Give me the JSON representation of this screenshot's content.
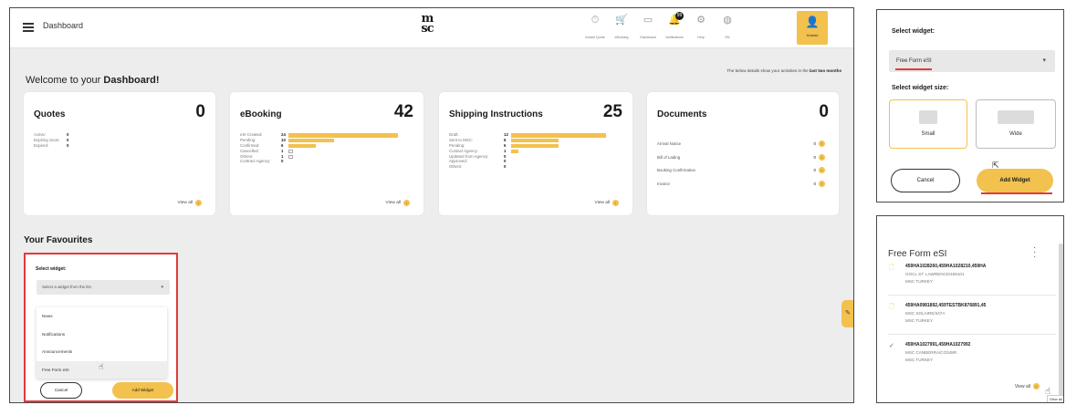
{
  "header": {
    "title": "Dashboard",
    "logo_top": "m",
    "logo_bottom": "sc",
    "nav": [
      {
        "icon": "instant-quote-icon",
        "glyph": "⏱",
        "label": "Instant Quote"
      },
      {
        "icon": "ebooking-icon",
        "glyph": "🛒",
        "label": "eBooking"
      },
      {
        "icon": "dashboard-icon",
        "glyph": "▭",
        "label": "Dashboard"
      },
      {
        "icon": "notifications-icon",
        "glyph": "🔔",
        "label": "Notifications",
        "badge": "99"
      },
      {
        "icon": "help-icon",
        "glyph": "⚙",
        "label": "Help"
      },
      {
        "icon": "language-icon",
        "glyph": "◍",
        "label": "EN"
      }
    ],
    "user_label": "Mustafa"
  },
  "welcome": {
    "prefix": "Welcome to your ",
    "bold": "Dashboard!"
  },
  "period_note": {
    "prefix": "The below details show your activities in the ",
    "bold": "last two months"
  },
  "cards": {
    "quotes": {
      "title": "Quotes",
      "count": "0",
      "rows": [
        {
          "label": "Active:",
          "value": "0"
        },
        {
          "label": "Expiring Soon:",
          "value": "0"
        },
        {
          "label": "Expired:",
          "value": "0"
        }
      ],
      "view_all": "View all"
    },
    "ebooking": {
      "title": "eBooking",
      "count": "42",
      "rows": [
        {
          "label": "eSI Created:",
          "value": "24",
          "fraction": 1.0
        },
        {
          "label": "Pending:",
          "value": "10",
          "fraction": 0.42
        },
        {
          "label": "Confirmed:",
          "value": "6",
          "fraction": 0.25
        },
        {
          "label": "Cancelled:",
          "value": "1",
          "fraction": 0.04
        },
        {
          "label": "Others:",
          "value": "1",
          "fraction": 0.04
        },
        {
          "label": "Contract Agency:",
          "value": "0",
          "fraction": 0
        }
      ],
      "view_all": "View all"
    },
    "shipping": {
      "title": "Shipping Instructions",
      "count": "25",
      "rows": [
        {
          "label": "Draft:",
          "value": "12",
          "fraction": 1.0
        },
        {
          "label": "Sent to MSC:",
          "value": "6",
          "fraction": 0.5
        },
        {
          "label": "Pending:",
          "value": "6",
          "fraction": 0.5
        },
        {
          "label": "Contact Agency:",
          "value": "1",
          "fraction": 0.08
        },
        {
          "label": "Updated from Agency:",
          "value": "0",
          "fraction": 0
        },
        {
          "label": "Approved:",
          "value": "0",
          "fraction": 0
        },
        {
          "label": "Others:",
          "value": "0",
          "fraction": 0
        }
      ],
      "view_all": "View all"
    },
    "documents": {
      "title": "Documents",
      "count": "0",
      "rows": [
        {
          "label": "Arrival Notice",
          "value": "0"
        },
        {
          "label": "Bill of Lading",
          "value": "0"
        },
        {
          "label": "Booking Confirmation",
          "value": "0"
        },
        {
          "label": "Invoice",
          "value": "0"
        }
      ]
    }
  },
  "favourites": {
    "title": "Your Favourites",
    "select_label": "Select widget:",
    "select_placeholder": "Select a widget from the list",
    "options": [
      "News",
      "Notifications",
      "Announcements",
      "Free Form eSI"
    ],
    "cancel": "Cancel",
    "add": "Add Widget"
  },
  "inset_select": {
    "label": "Select widget:",
    "selected": "Free Form eSI",
    "size_label": "Select widget size:",
    "sizes": [
      "Small",
      "Wide"
    ],
    "cancel": "Cancel",
    "add": "Add Widget"
  },
  "inset_widget": {
    "title": "Free Form eSI",
    "entries": [
      {
        "ref": "459HA1028260,459HA1028210,459HA",
        "line2": "OOCL ST. LAWRENCE/459101",
        "line3": "MSC TURKEY",
        "icon": "document-icon"
      },
      {
        "ref": "459HA0981892,459TESTBK876891,45",
        "line2": "MSC SOLAIRE/347A",
        "line3": "MSC TURKEY",
        "icon": "document-icon"
      },
      {
        "ref": "459HA1027991,459HA1027992",
        "line2": "MSC CANBERRA/CO348R",
        "line3": "MSC TURKEY",
        "icon": "check-icon"
      }
    ],
    "view_all": "View all",
    "tooltip": "View all"
  },
  "colors": {
    "accent": "#f2c14e",
    "highlight": "#e23a3a",
    "background": "#ededed"
  }
}
